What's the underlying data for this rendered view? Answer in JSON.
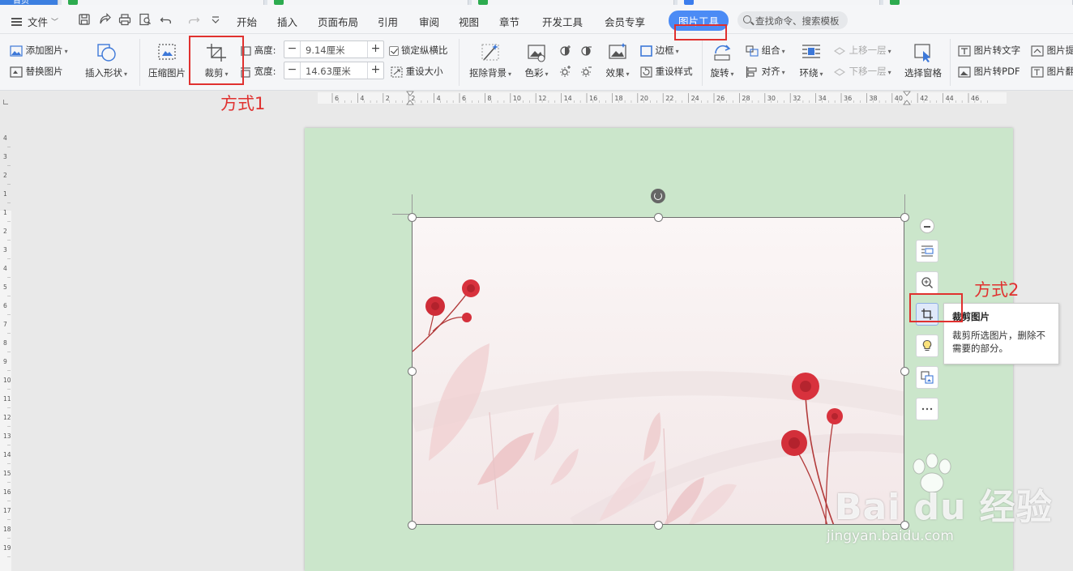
{
  "doc_tabs": [
    {
      "label": "首页",
      "kind": "home"
    },
    {
      "label": "...",
      "kind": "xls"
    },
    {
      "label": "...",
      "kind": "xls"
    },
    {
      "label": "...",
      "kind": "xls"
    },
    {
      "label": "...",
      "kind": "doc"
    },
    {
      "label": "...",
      "kind": "xls"
    }
  ],
  "menubar": {
    "file": "文件",
    "items": [
      "开始",
      "插入",
      "页面布局",
      "引用",
      "审阅",
      "视图",
      "章节",
      "开发工具",
      "会员专享",
      "图片工具"
    ],
    "active_item": "图片工具",
    "search_placeholder": "查找命令、搜索模板"
  },
  "ribbon": {
    "add_picture": "添加图片",
    "replace_picture": "替换图片",
    "insert_shape": "插入形状",
    "compress_picture": "压缩图片",
    "crop": "裁剪",
    "height_label": "高度:",
    "height_value": "9.14厘米",
    "width_label": "宽度:",
    "width_value": "14.63厘米",
    "lock_ratio": "锁定纵横比",
    "reset_size": "重设大小",
    "remove_bg": "抠除背景",
    "color": "色彩",
    "effect": "效果",
    "border": "边框",
    "reset_style": "重设样式",
    "rotate": "旋转",
    "group": "组合",
    "align": "对齐",
    "wrap": "环绕",
    "bring_forward": "上移一层",
    "send_backward": "下移一层",
    "selection_pane": "选择窗格",
    "pic_to_text": "图片转文字",
    "pic_to_pdf": "图片转PDF",
    "pic_extract": "图片提",
    "pic_translate": "图片翻"
  },
  "ruler": {
    "h_ticks": [
      "6",
      "4",
      "2",
      "2",
      "4",
      "6",
      "8",
      "10",
      "12",
      "14",
      "16",
      "18",
      "20",
      "22",
      "24",
      "26",
      "28",
      "30",
      "32",
      "34",
      "36",
      "38",
      "40",
      "42",
      "44",
      "46"
    ],
    "v_ticks": [
      "4",
      "3",
      "2",
      "1",
      "1",
      "2",
      "3",
      "4",
      "5",
      "6",
      "7",
      "8",
      "9",
      "10",
      "11",
      "12",
      "13",
      "14",
      "15",
      "16",
      "17",
      "18",
      "19"
    ]
  },
  "tooltip": {
    "title": "裁剪图片",
    "description": "裁剪所选图片，删除不需要的部分。"
  },
  "annotations": {
    "method1": "方式1",
    "method2": "方式2"
  },
  "watermark": {
    "main": "Bai du 经验",
    "sub": "jingyan.baidu.com"
  },
  "colors": {
    "accent": "#4b8bf5",
    "annotation_red": "#e0312f",
    "page_bg": "#cbe6cb"
  }
}
